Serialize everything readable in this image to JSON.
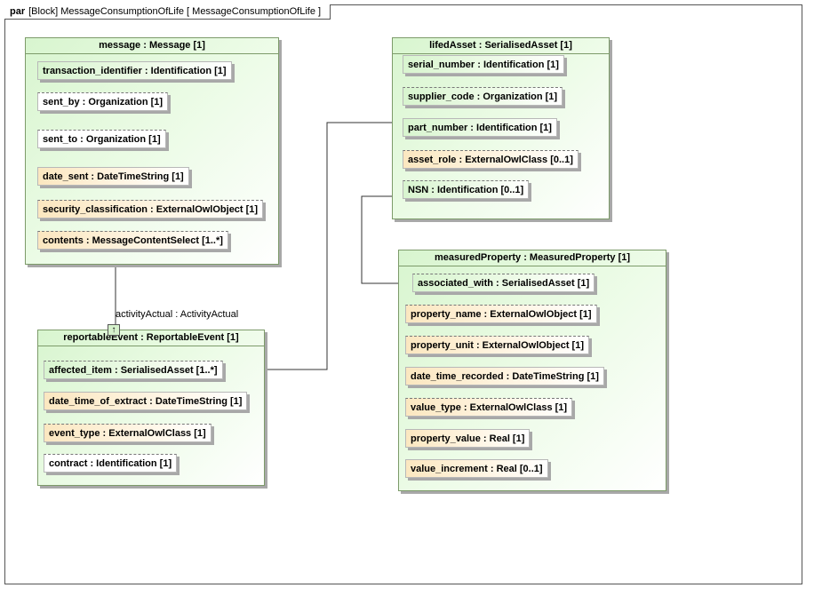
{
  "diagram": {
    "frame_kind": "par",
    "frame_title": "[Block] MessageConsumptionOfLife [ MessageConsumptionOfLife ]"
  },
  "message": {
    "title": "message : Message [1]",
    "properties": [
      "transaction_identifier : Identification [1]",
      "sent_by : Organization [1]",
      "sent_to : Organization [1]",
      "date_sent : DateTimeString [1]",
      "security_classification : ExternalOwlObject [1]",
      "contents : MessageContentSelect [1..*]"
    ]
  },
  "lifedAsset": {
    "title": "lifedAsset : SerialisedAsset [1]",
    "properties": [
      "serial_number : Identification [1]",
      "supplier_code : Organization [1]",
      "part_number : Identification [1]",
      "asset_role : ExternalOwlClass [0..1]",
      "NSN : Identification [0..1]"
    ]
  },
  "reportableEvent": {
    "title": "reportableEvent : ReportableEvent [1]",
    "properties": [
      "affected_item : SerialisedAsset [1..*]",
      "date_time_of_extract : DateTimeString [1]",
      "event_type : ExternalOwlClass [1]",
      "contract : Identification [1]"
    ]
  },
  "measuredProperty": {
    "title": "measuredProperty : MeasuredProperty [1]",
    "properties": [
      "associated_with : SerialisedAsset [1]",
      "property_name : ExternalOwlObject [1]",
      "property_unit : ExternalOwlObject [1]",
      "date_time_recorded : DateTimeString [1]",
      "value_type : ExternalOwlClass [1]",
      "property_value : Real [1]",
      "value_increment : Real [0..1]"
    ]
  },
  "connector": {
    "label": "activityActual : ActivityActual",
    "port_glyph": "↑"
  }
}
